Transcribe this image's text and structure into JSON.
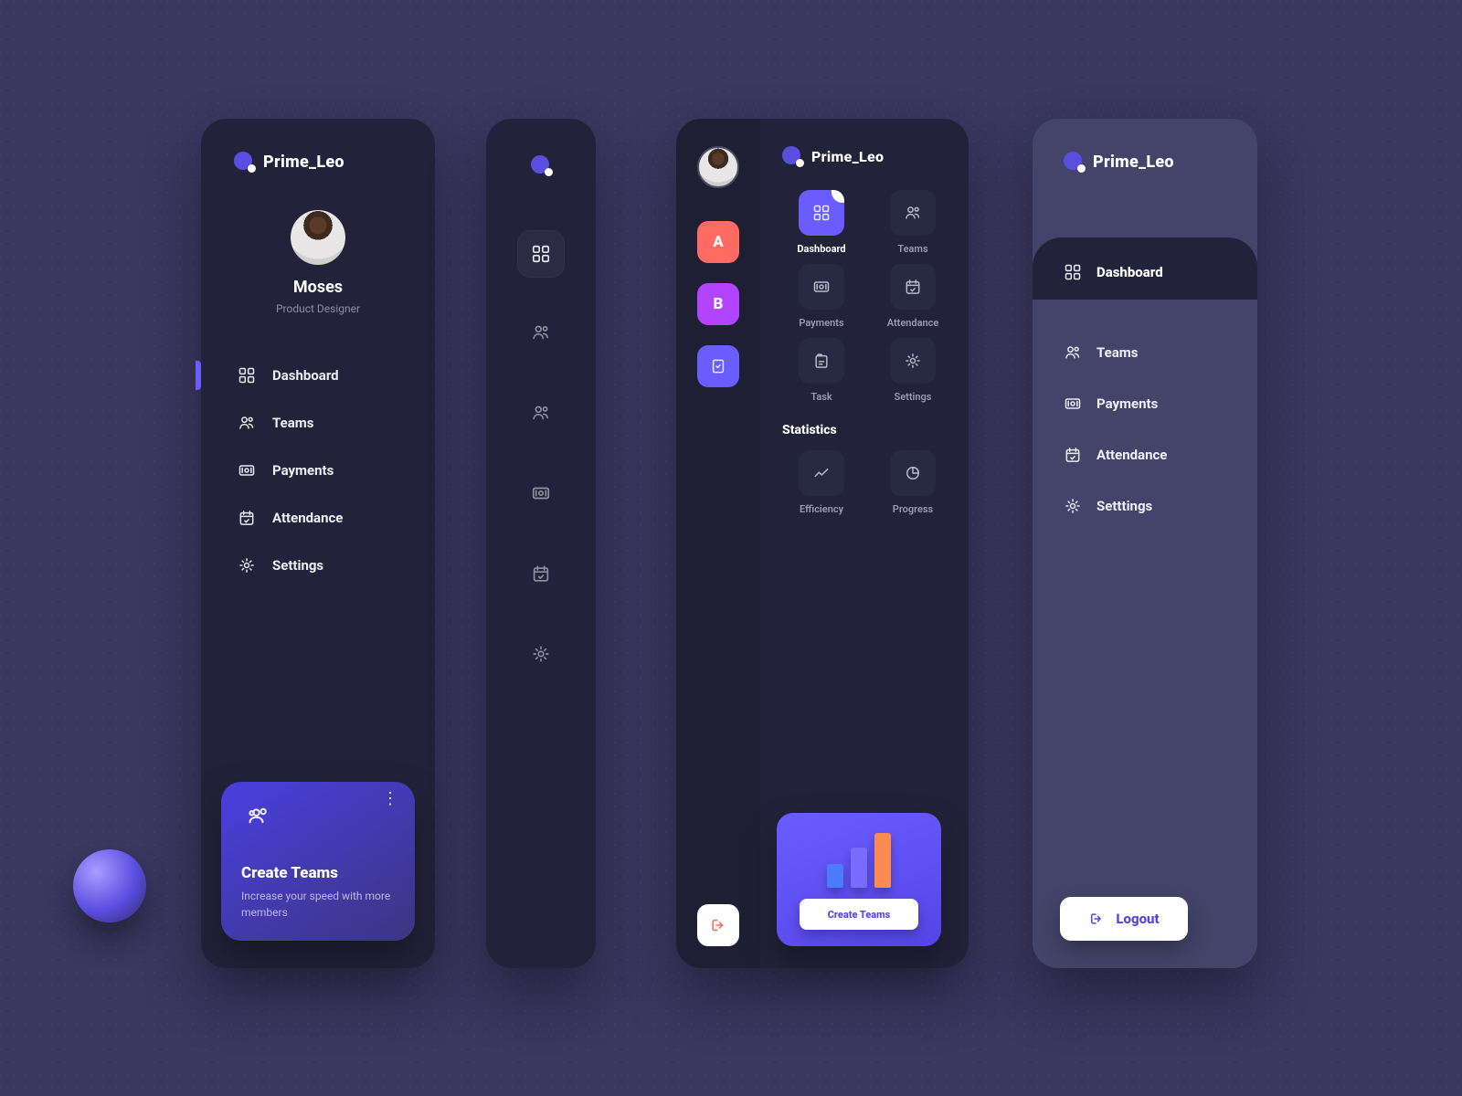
{
  "brand": "Prime_Leo",
  "user": {
    "name": "Moses",
    "role": "Product Designer"
  },
  "panel1": {
    "nav": {
      "dashboard": "Dashboard",
      "teams": "Teams",
      "payments": "Payments",
      "attendance": "Attendance",
      "settings": "Settings"
    },
    "promo": {
      "title": "Create  Teams",
      "subtitle": "Increase your speed with more members"
    }
  },
  "panel3": {
    "workspaces": {
      "a": "A",
      "b": "B"
    },
    "tiles": {
      "dashboard": "Dashboard",
      "teams": "Teams",
      "payments": "Payments",
      "attendance": "Attendance",
      "task": "Task",
      "settings": "Settings"
    },
    "section": "Statistics",
    "stats": {
      "efficiency": "Efficiency",
      "progress": "Progress"
    },
    "cta": "Create  Teams"
  },
  "panel4": {
    "nav": {
      "dashboard": "Dashboard",
      "teams": "Teams",
      "payments": "Payments",
      "attendance": "Attendance",
      "settings": "Setttings"
    },
    "logout": "Logout"
  }
}
